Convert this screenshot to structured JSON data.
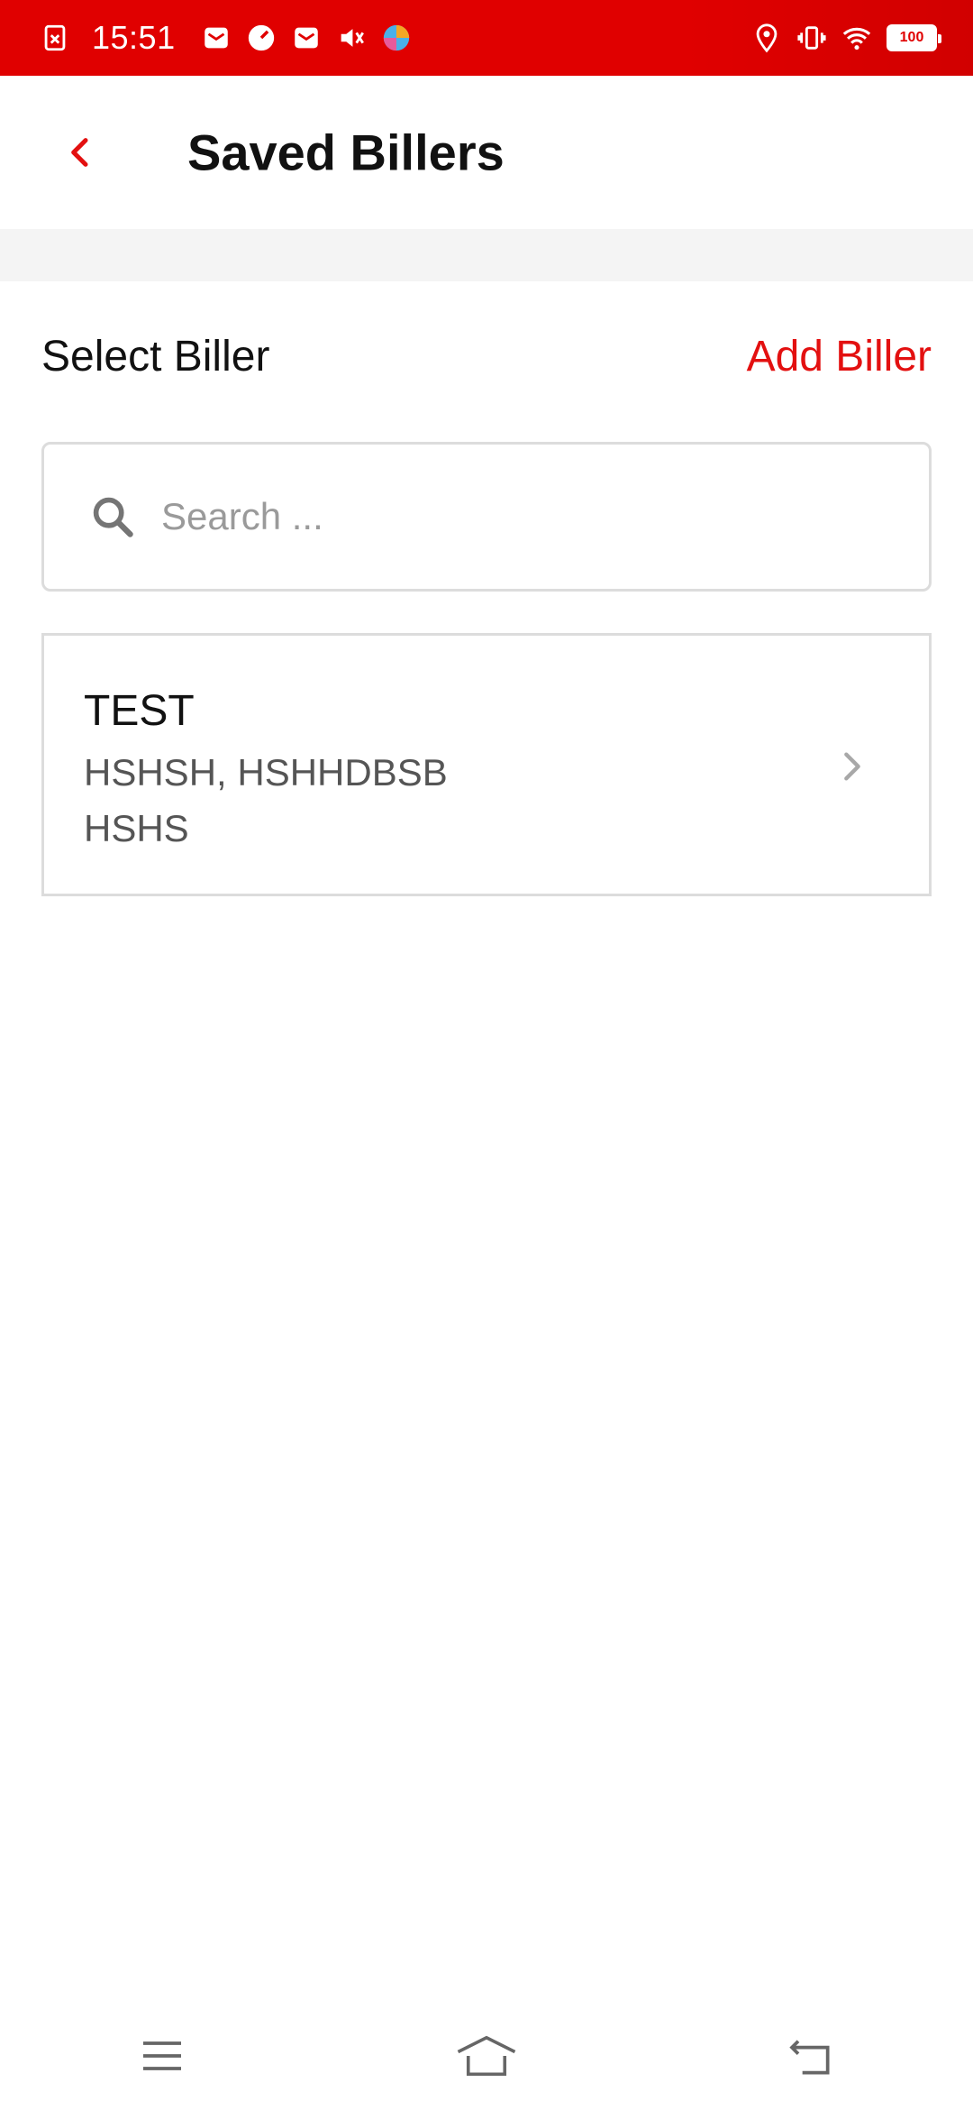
{
  "status_bar": {
    "time": "15:51",
    "battery": "100",
    "left_icons": [
      "sim-error-icon",
      "mail-icon",
      "speed-icon",
      "mail-icon",
      "mute-icon",
      "browser-icon"
    ],
    "right_icons": [
      "location-icon",
      "vibrate-icon",
      "wifi-icon"
    ]
  },
  "header": {
    "title": "Saved Billers"
  },
  "select_row": {
    "label": "Select Biller",
    "add_button": "Add Biller"
  },
  "search": {
    "placeholder": "Search ..."
  },
  "billers": [
    {
      "name": "TEST",
      "line1": "HSHSH, HSHHDBSB",
      "line2": "HSHS"
    }
  ],
  "colors": {
    "accent": "#e31010",
    "status_bar": "#e00000",
    "border": "#dcdcdc",
    "divider": "#f4f4f4"
  }
}
